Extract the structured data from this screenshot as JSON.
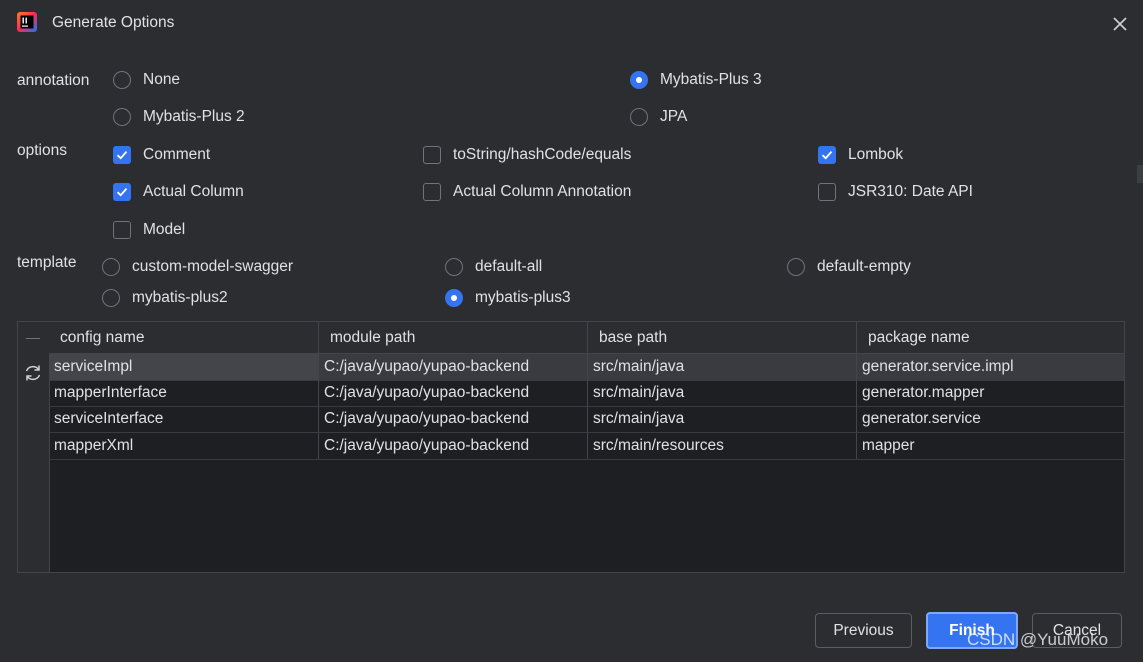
{
  "window": {
    "title": "Generate Options",
    "app_icon": "intellij-idea-icon",
    "close_icon": "close-icon"
  },
  "annotation": {
    "label": "annotation",
    "options": [
      {
        "label": "None",
        "selected": false
      },
      {
        "label": "Mybatis-Plus 3",
        "selected": true
      },
      {
        "label": "Mybatis-Plus 2",
        "selected": false
      },
      {
        "label": "JPA",
        "selected": false
      }
    ]
  },
  "options": {
    "label": "options",
    "items": [
      {
        "label": "Comment",
        "checked": true
      },
      {
        "label": "toString/hashCode/equals",
        "checked": false
      },
      {
        "label": "Lombok",
        "checked": true
      },
      {
        "label": "Actual Column",
        "checked": true
      },
      {
        "label": "Actual Column Annotation",
        "checked": false
      },
      {
        "label": "JSR310: Date API",
        "checked": false
      },
      {
        "label": "Model",
        "checked": false
      }
    ]
  },
  "template": {
    "label": "template",
    "options": [
      {
        "label": "custom-model-swagger",
        "selected": false
      },
      {
        "label": "default-all",
        "selected": false
      },
      {
        "label": "default-empty",
        "selected": false
      },
      {
        "label": "mybatis-plus2",
        "selected": false
      },
      {
        "label": "mybatis-plus3",
        "selected": true
      }
    ]
  },
  "table": {
    "columns": [
      "config name",
      "module path",
      "base path",
      "package name"
    ],
    "rows": [
      [
        "serviceImpl",
        "C:/java/yupao/yupao-backend",
        "src/main/java",
        "generator.service.impl"
      ],
      [
        "mapperInterface",
        "C:/java/yupao/yupao-backend",
        "src/main/java",
        "generator.mapper"
      ],
      [
        "serviceInterface",
        "C:/java/yupao/yupao-backend",
        "src/main/java",
        "generator.service"
      ],
      [
        "mapperXml",
        "C:/java/yupao/yupao-backend",
        "src/main/resources",
        "mapper"
      ]
    ],
    "selected_row": 0,
    "refresh_icon": "refresh-icon"
  },
  "buttons": {
    "previous": "Previous",
    "finish": "Finish",
    "cancel": "Cancel"
  },
  "watermark": "CSDN @YuuMoko",
  "colors": {
    "background": "#2b2d30",
    "accent": "#3574f0",
    "table_bg": "#1e1f22",
    "text": "#dfe1e5"
  }
}
